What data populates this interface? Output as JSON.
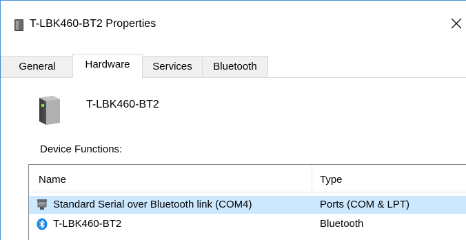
{
  "window": {
    "title": "T-LBK460-BT2 Properties",
    "title_icon": "bluetooth-device-icon",
    "close_icon": "close-icon"
  },
  "tabs": [
    {
      "label": "General",
      "active": false
    },
    {
      "label": "Hardware",
      "active": true
    },
    {
      "label": "Services",
      "active": false
    },
    {
      "label": "Bluetooth",
      "active": false
    }
  ],
  "device": {
    "icon": "device-icon",
    "name": "T-LBK460-BT2"
  },
  "functions": {
    "label": "Device Functions:",
    "columns": [
      "Name",
      "Type"
    ],
    "rows": [
      {
        "icon": "serial-port-icon",
        "name": "Standard Serial over Bluetooth link (COM4)",
        "type": "Ports (COM & LPT)",
        "selected": true
      },
      {
        "icon": "bluetooth-icon",
        "name": "T-LBK460-BT2",
        "type": "Bluetooth",
        "selected": false
      }
    ]
  },
  "colors": {
    "selection": "#cce8ff",
    "bluetooth": "#1e88e5",
    "led": "#7ddc4a"
  }
}
